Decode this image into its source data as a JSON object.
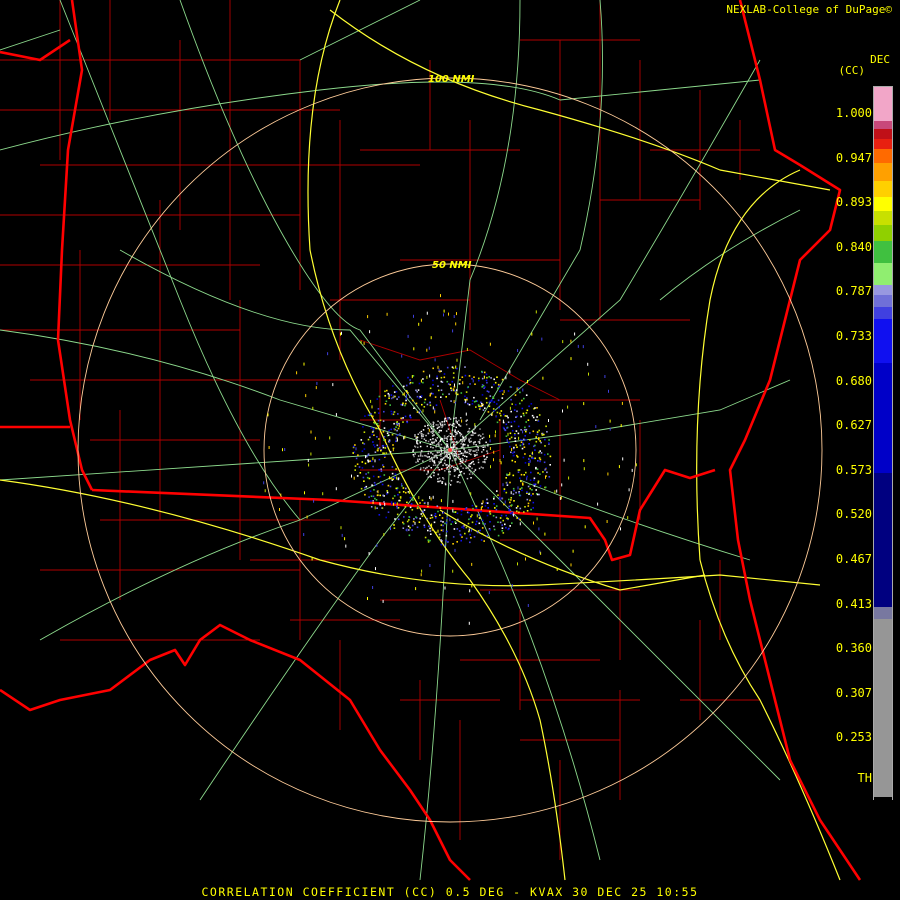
{
  "header": {
    "credit": "NEXLAB-College of DuPage",
    "credit_mark": "©"
  },
  "product": {
    "title": "CORRELATION COEFFICIENT (CC) 0.5 DEG - KVAX 30 DEC 25 10:55"
  },
  "rings": [
    {
      "label": "50 NMI"
    },
    {
      "label": "100 NMI"
    }
  ],
  "legend": {
    "header_line1": "DEC",
    "header_line2": "(CC)",
    "ticks": [
      "1.000",
      "0.947",
      "0.893",
      "0.840",
      "0.787",
      "0.733",
      "0.680",
      "0.627",
      "0.573",
      "0.520",
      "0.467",
      "0.413",
      "0.360",
      "0.307",
      "0.253",
      "TH"
    ],
    "bands": [
      {
        "value": "1.000",
        "color": "#f2a6c8"
      },
      {
        "value": "0.980",
        "color": "#c8487a"
      },
      {
        "value": "0.970",
        "color": "#c01018"
      },
      {
        "value": "0.960",
        "color": "#e82010"
      },
      {
        "value": "0.947",
        "color": "#ff6a00"
      },
      {
        "value": "0.930",
        "color": "#ffa000"
      },
      {
        "value": "0.910",
        "color": "#ffd000"
      },
      {
        "value": "0.893",
        "color": "#ffff00"
      },
      {
        "value": "0.870",
        "color": "#c8e000"
      },
      {
        "value": "0.850",
        "color": "#90d000"
      },
      {
        "value": "0.820",
        "color": "#40c040"
      },
      {
        "value": "0.787",
        "color": "#90ee70"
      },
      {
        "value": "0.760",
        "color": "#9898e0"
      },
      {
        "value": "0.740",
        "color": "#7070d8"
      },
      {
        "value": "0.720",
        "color": "#4040e0"
      },
      {
        "value": "0.700",
        "color": "#1010f0"
      },
      {
        "value": "0.600",
        "color": "#0000c8"
      },
      {
        "value": "0.450",
        "color": "#000080"
      },
      {
        "value": "0.413",
        "color": "#7878a0"
      },
      {
        "value": "0.200",
        "color": "#969696"
      },
      {
        "value": "TH",
        "color": "#000000"
      }
    ],
    "colors": {
      "state_lines": "#ff0000",
      "county_lines": "#b00000",
      "highways_major": "#ffff33",
      "highways_minor": "#8cd98c",
      "range_rings": "#ffcc99"
    }
  }
}
